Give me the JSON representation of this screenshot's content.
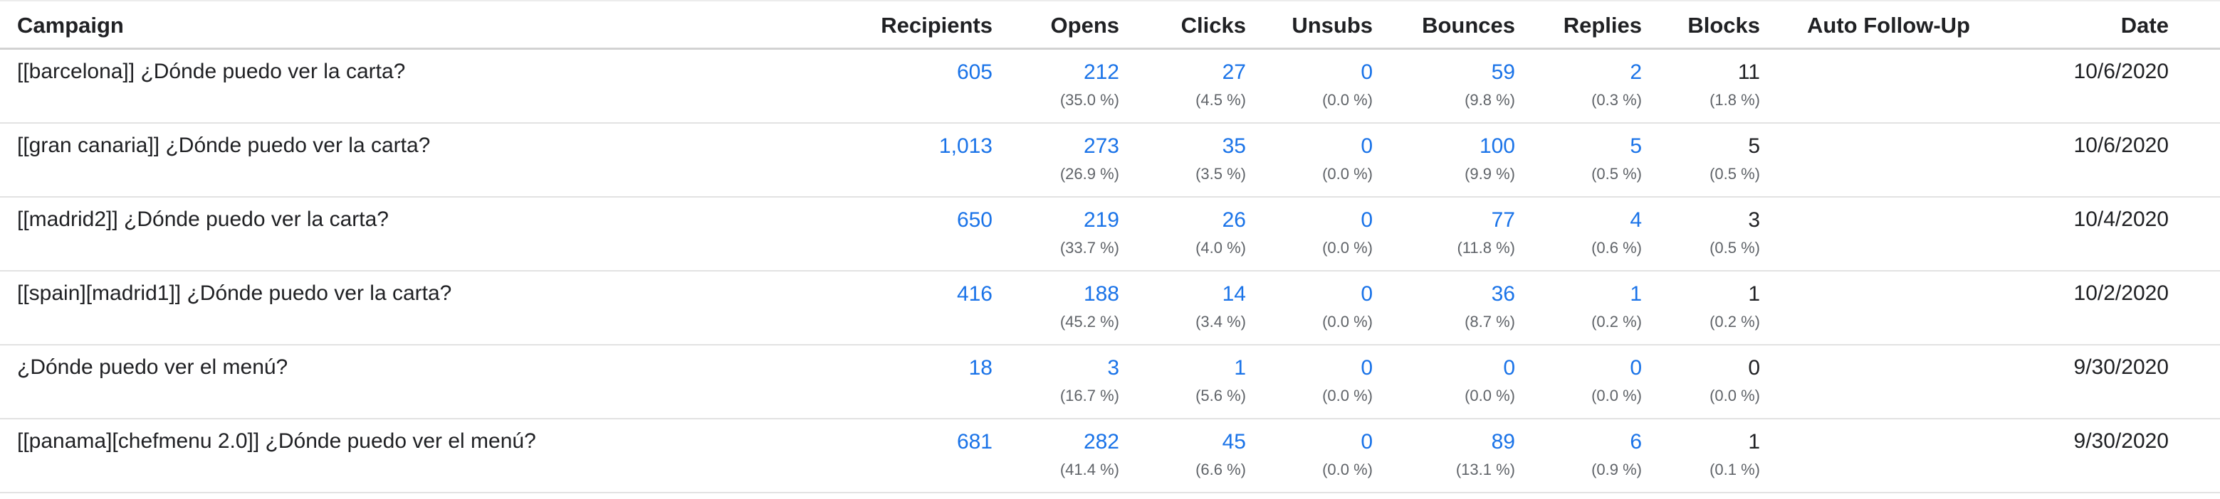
{
  "columns": {
    "campaign": "Campaign",
    "recipients": "Recipients",
    "opens": "Opens",
    "clicks": "Clicks",
    "unsubs": "Unsubs",
    "bounces": "Bounces",
    "replies": "Replies",
    "blocks": "Blocks",
    "auto_follow_up": "Auto Follow-Up",
    "date": "Date"
  },
  "colors": {
    "link_blue": "#1a73e8",
    "text": "#202124",
    "muted": "#5f6368"
  },
  "rows": [
    {
      "campaign": "[[barcelona]] ¿Dónde puedo ver la carta?",
      "recipients": "605",
      "opens": "212",
      "opens_pct": "(35.0 %)",
      "clicks": "27",
      "clicks_pct": "(4.5 %)",
      "unsubs": "0",
      "unsubs_pct": "(0.0 %)",
      "bounces": "59",
      "bounces_pct": "(9.8 %)",
      "replies": "2",
      "replies_pct": "(0.3 %)",
      "blocks": "11",
      "blocks_pct": "(1.8 %)",
      "auto_follow_up": "",
      "date": "10/6/2020"
    },
    {
      "campaign": "[[gran canaria]] ¿Dónde puedo ver la carta?",
      "recipients": "1,013",
      "opens": "273",
      "opens_pct": "(26.9 %)",
      "clicks": "35",
      "clicks_pct": "(3.5 %)",
      "unsubs": "0",
      "unsubs_pct": "(0.0 %)",
      "bounces": "100",
      "bounces_pct": "(9.9 %)",
      "replies": "5",
      "replies_pct": "(0.5 %)",
      "blocks": "5",
      "blocks_pct": "(0.5 %)",
      "auto_follow_up": "",
      "date": "10/6/2020"
    },
    {
      "campaign": "[[madrid2]] ¿Dónde puedo ver la carta?",
      "recipients": "650",
      "opens": "219",
      "opens_pct": "(33.7 %)",
      "clicks": "26",
      "clicks_pct": "(4.0 %)",
      "unsubs": "0",
      "unsubs_pct": "(0.0 %)",
      "bounces": "77",
      "bounces_pct": "(11.8 %)",
      "replies": "4",
      "replies_pct": "(0.6 %)",
      "blocks": "3",
      "blocks_pct": "(0.5 %)",
      "auto_follow_up": "",
      "date": "10/4/2020"
    },
    {
      "campaign": "[[spain][madrid1]] ¿Dónde puedo ver la carta?",
      "recipients": "416",
      "opens": "188",
      "opens_pct": "(45.2 %)",
      "clicks": "14",
      "clicks_pct": "(3.4 %)",
      "unsubs": "0",
      "unsubs_pct": "(0.0 %)",
      "bounces": "36",
      "bounces_pct": "(8.7 %)",
      "replies": "1",
      "replies_pct": "(0.2 %)",
      "blocks": "1",
      "blocks_pct": "(0.2 %)",
      "auto_follow_up": "",
      "date": "10/2/2020"
    },
    {
      "campaign": "¿Dónde puedo ver el menú?",
      "recipients": "18",
      "opens": "3",
      "opens_pct": "(16.7 %)",
      "clicks": "1",
      "clicks_pct": "(5.6 %)",
      "unsubs": "0",
      "unsubs_pct": "(0.0 %)",
      "bounces": "0",
      "bounces_pct": "(0.0 %)",
      "replies": "0",
      "replies_pct": "(0.0 %)",
      "blocks": "0",
      "blocks_pct": "(0.0 %)",
      "auto_follow_up": "",
      "date": "9/30/2020"
    },
    {
      "campaign": "[[panama][chefmenu 2.0]] ¿Dónde puedo ver el menú?",
      "recipients": "681",
      "opens": "282",
      "opens_pct": "(41.4 %)",
      "clicks": "45",
      "clicks_pct": "(6.6 %)",
      "unsubs": "0",
      "unsubs_pct": "(0.0 %)",
      "bounces": "89",
      "bounces_pct": "(13.1 %)",
      "replies": "6",
      "replies_pct": "(0.9 %)",
      "blocks": "1",
      "blocks_pct": "(0.1 %)",
      "auto_follow_up": "",
      "date": "9/30/2020"
    }
  ]
}
